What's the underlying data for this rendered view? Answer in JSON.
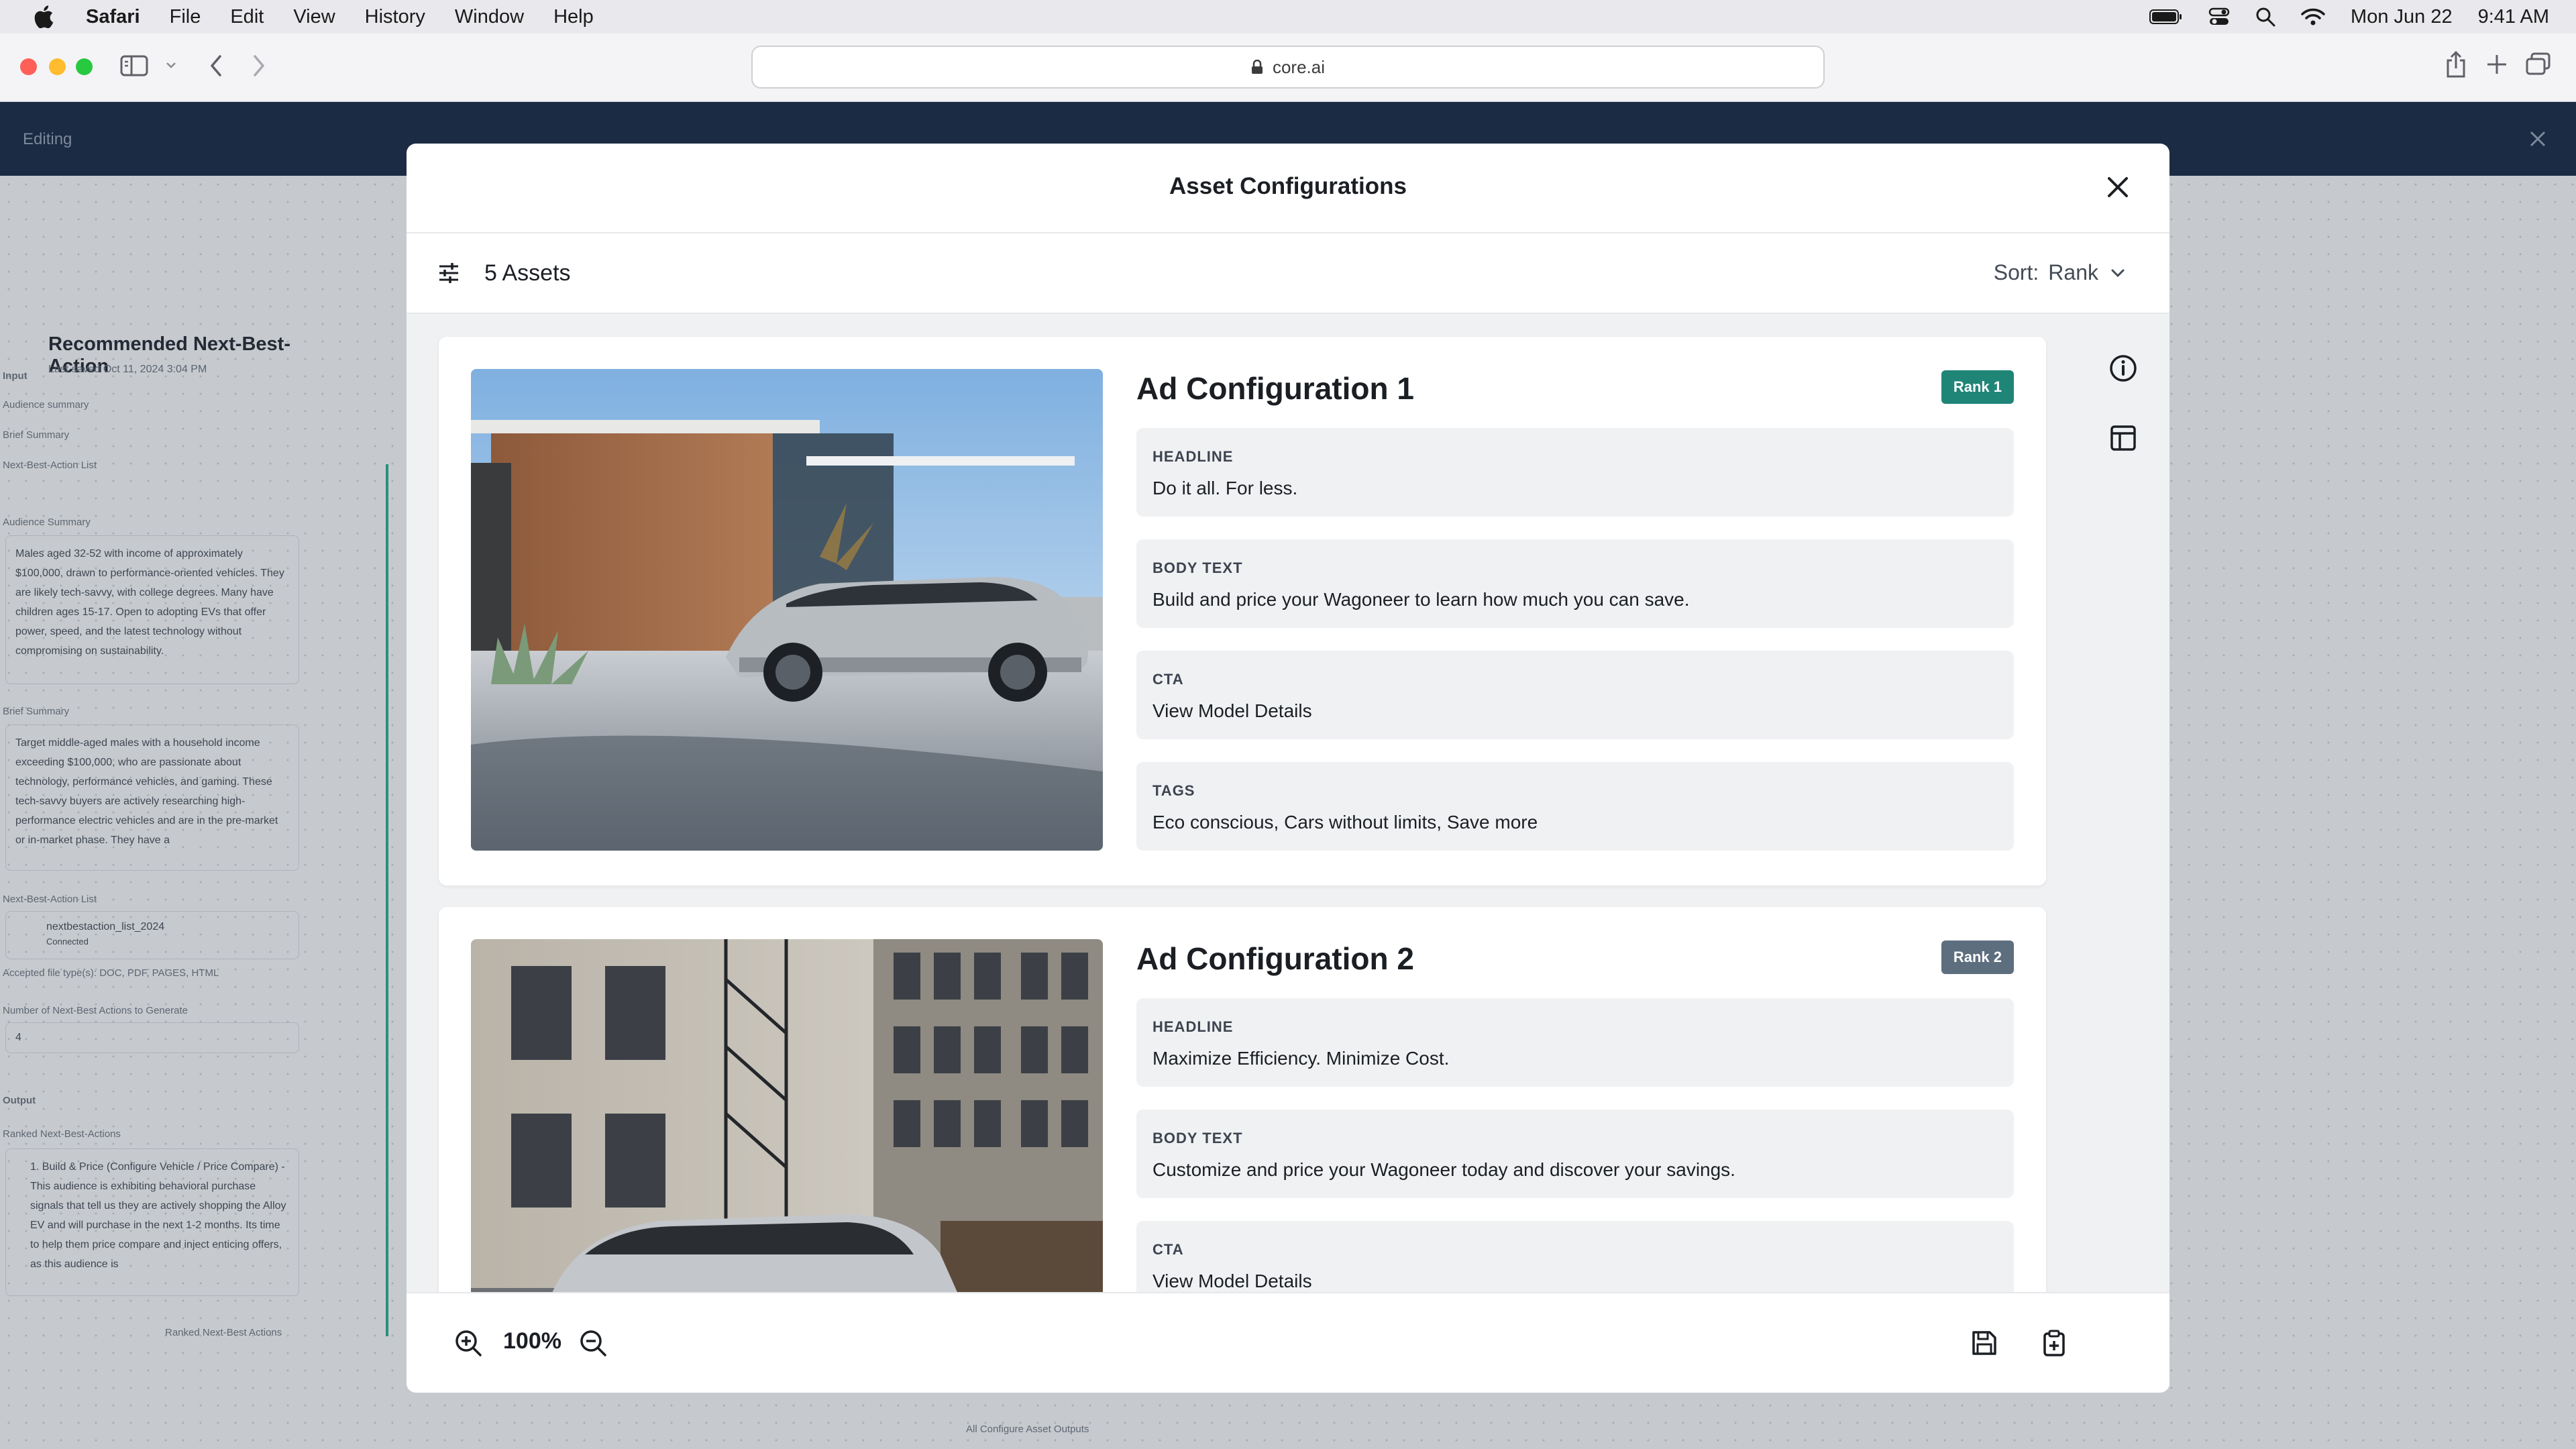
{
  "menubar": {
    "app_name": "Safari",
    "items": [
      "File",
      "Edit",
      "View",
      "History",
      "Window",
      "Help"
    ],
    "date": "Mon Jun 22",
    "time": "9:41 AM"
  },
  "browser": {
    "url": "core.ai"
  },
  "background_app": {
    "status": "Editing",
    "node_title": "Recommended Next-Best-Action",
    "last_saved": "Last saved Oct 11, 2024 3:04 PM",
    "input_label": "Input",
    "input_items": [
      "Audience summary",
      "Brief Summary",
      "Next-Best-Action List"
    ],
    "audience_summary_label": "Audience Summary",
    "audience_summary": "Males aged 32-52 with income of approximately $100,000, drawn to performance-oriented vehicles. They are likely tech-savvy, with college degrees. Many have children ages 15-17. Open to adopting EVs that offer power, speed, and the latest technology without compromising on sustainability.",
    "brief_summary_label": "Brief Summary",
    "brief_summary": "Target middle-aged males with a household income exceeding $100,000, who are passionate about technology, performance vehicles, and gaming. These tech-savvy buyers are actively researching high-performance electric vehicles and are in the pre-market or in-market phase. They have a",
    "nba_list_label": "Next-Best-Action List",
    "nba_file": "nextbestaction_list_2024",
    "nba_file_status": "Connected",
    "accepted_types": "Accepted file type(s): DOC, PDF, PAGES, HTML",
    "num_actions_label": "Number of Next-Best Actions to Generate",
    "num_actions_value": "4",
    "output_label": "Output",
    "ranked_label": "Ranked Next-Best-Actions",
    "ranked_text": "1. Build & Price (Configure Vehicle / Price Compare) - This audience is exhibiting behavioral purchase signals that tell us they are actively shopping the Alloy EV and will purchase in the next 1-2 months. Its time to help them price compare and inject enticing offers, as this audience is",
    "ranked_port": "Ranked Next-Best Actions",
    "bottom_port": "All Configure Asset Outputs"
  },
  "modal": {
    "title": "Asset Configurations",
    "asset_count": "5 Assets",
    "sort_label": "Sort:",
    "sort_value": "Rank",
    "zoom_level": "100%",
    "cards": [
      {
        "title": "Ad Configuration 1",
        "rank": "Rank 1",
        "rank_color": "#1f8577",
        "fields": [
          {
            "label": "HEADLINE",
            "value": "Do it all. For less."
          },
          {
            "label": "BODY TEXT",
            "value": "Build and price your Wagoneer to learn how much you can save."
          },
          {
            "label": "CTA",
            "value": "View Model Details"
          },
          {
            "label": "TAGS",
            "value": "Eco conscious, Cars without limits, Save more"
          }
        ]
      },
      {
        "title": "Ad Configuration 2",
        "rank": "Rank 2",
        "rank_color": "#5d6e7e",
        "fields": [
          {
            "label": "HEADLINE",
            "value": "Maximize Efficiency. Minimize Cost."
          },
          {
            "label": "BODY TEXT",
            "value": "Customize and price your Wagoneer today and discover your savings."
          },
          {
            "label": "CTA",
            "value": "View Model Details"
          }
        ]
      }
    ]
  },
  "icons": {
    "close": "close-icon",
    "filter": "sliders-icon",
    "sort": "chevron-down-icon",
    "info": "info-icon",
    "layout": "layout-icon",
    "zoom_in": "zoom-in-icon",
    "zoom_out": "zoom-out-icon",
    "save": "save-icon",
    "export": "clipboard-plus-icon"
  }
}
